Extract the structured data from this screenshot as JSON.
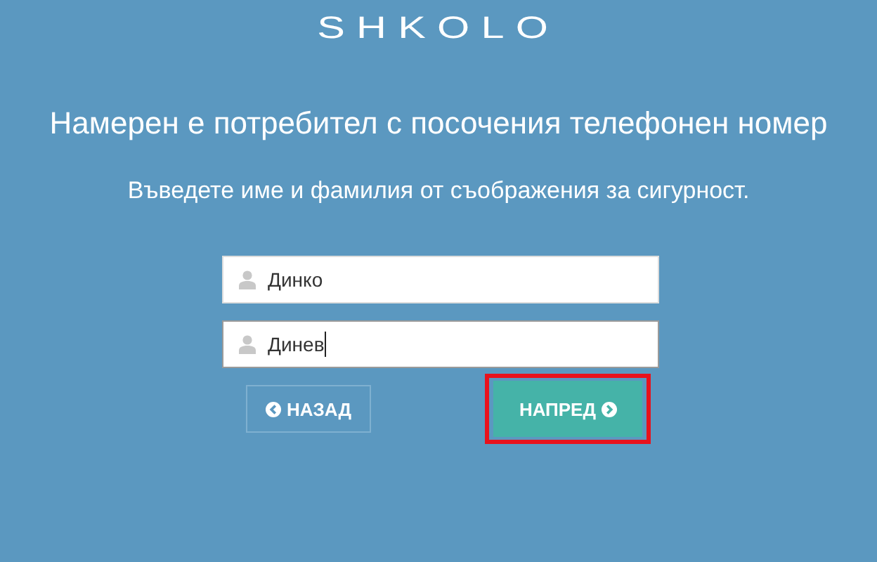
{
  "logo": "SHKOLO",
  "title": "Намерен е потребител с посочения телефонен номер",
  "subtitle": "Въведете име и фамилия от съображения за сигурност.",
  "fields": [
    {
      "value": "Динко",
      "focused": false
    },
    {
      "value": "Динев",
      "focused": true
    }
  ],
  "buttons": [
    {
      "label": "НАЗАД",
      "kind": "back",
      "highlighted": false
    },
    {
      "label": "НАПРЕД",
      "kind": "next",
      "highlighted": true
    }
  ]
}
